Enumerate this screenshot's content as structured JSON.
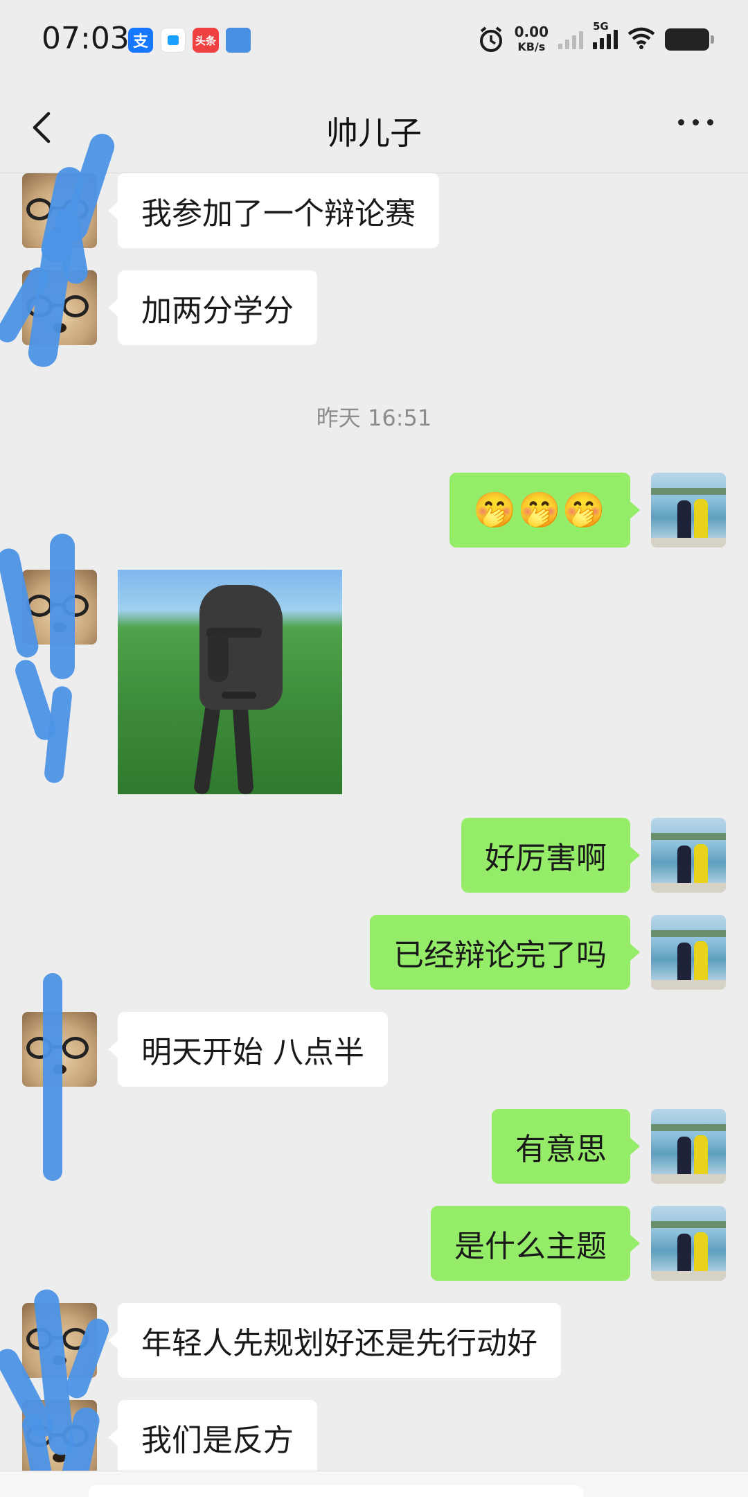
{
  "status_bar": {
    "time": "07:03",
    "notification_icons": [
      "alipay-icon",
      "message-app-icon",
      "toutiao-icon",
      "file-app-icon"
    ],
    "toutiao_label": "头条",
    "alipay_label": "支",
    "net_speed_value": "0.00",
    "net_speed_unit": "KB/s",
    "network_type": "5G"
  },
  "header": {
    "title": "帅儿子",
    "back_icon": "chevron-left-icon",
    "more_icon": "ellipsis-icon"
  },
  "messages": [
    {
      "side": "in",
      "type": "text",
      "text": "我参加了一个辩论赛"
    },
    {
      "side": "in",
      "type": "text",
      "text": "加两分学分"
    },
    {
      "type": "timestamp",
      "text": "昨天 16:51"
    },
    {
      "side": "out",
      "type": "emoji",
      "text": "🤭🤭🤭"
    },
    {
      "side": "in",
      "type": "image",
      "description": "sticker"
    },
    {
      "side": "out",
      "type": "text",
      "text": "好厉害啊"
    },
    {
      "side": "out",
      "type": "text",
      "text": "已经辩论完了吗"
    },
    {
      "side": "in",
      "type": "text",
      "text": "明天开始 八点半"
    },
    {
      "side": "out",
      "type": "text",
      "text": "有意思"
    },
    {
      "side": "out",
      "type": "text",
      "text": "是什么主题"
    },
    {
      "side": "in",
      "type": "text",
      "text": "年轻人先规划好还是先行动好"
    },
    {
      "side": "in",
      "type": "text",
      "text": "我们是反方"
    }
  ],
  "colors": {
    "background": "#ededed",
    "incoming_bubble": "#ffffff",
    "outgoing_bubble": "#95ec69",
    "timestamp_text": "#8c8c8c",
    "scribble": "#4c93e6"
  }
}
